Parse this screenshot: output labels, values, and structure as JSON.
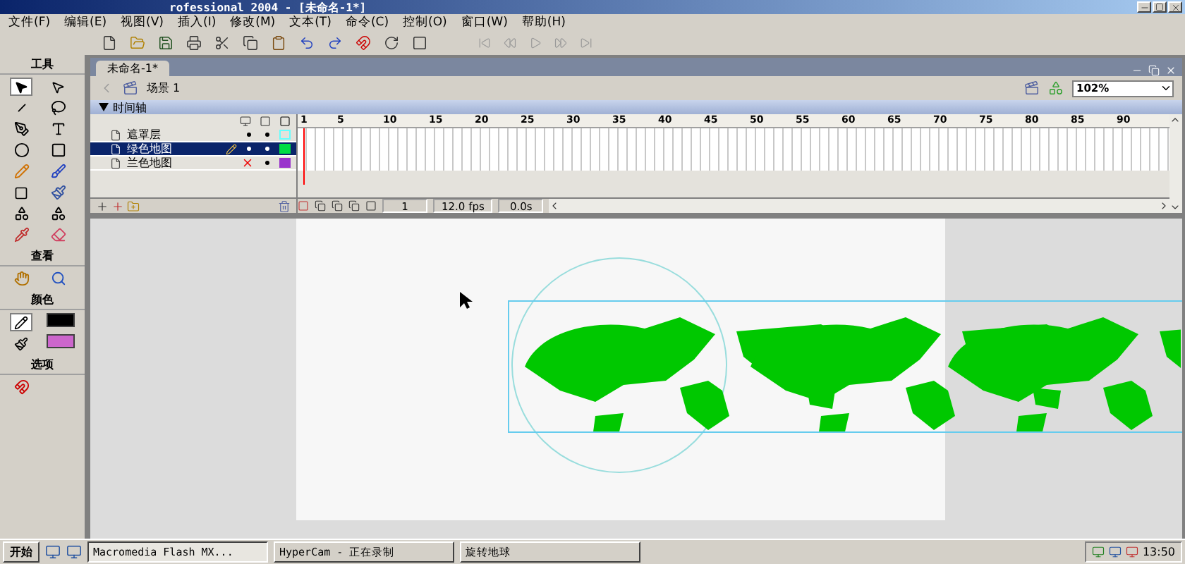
{
  "window": {
    "title": "rofessional 2004 - [未命名-1*]"
  },
  "menu": [
    "文件(F)",
    "编辑(E)",
    "视图(V)",
    "插入(I)",
    "修改(M)",
    "文本(T)",
    "命令(C)",
    "控制(O)",
    "窗口(W)",
    "帮助(H)"
  ],
  "tools_panel": {
    "sections": [
      "工具",
      "查看",
      "颜色",
      "选项"
    ]
  },
  "document": {
    "tab": "未命名-1*",
    "scene": "场景 1",
    "zoom": "102%"
  },
  "timeline": {
    "title": "时间轴",
    "expanded": true,
    "ruler": [
      "1",
      "5",
      "10",
      "15",
      "20",
      "25",
      "30",
      "35",
      "40",
      "45",
      "50",
      "55",
      "60",
      "65",
      "70",
      "75",
      "80",
      "85",
      "90"
    ],
    "layers": [
      {
        "name": "遮罩层",
        "selected": false,
        "hidden": false,
        "color": "#66ffff"
      },
      {
        "name": "绿色地图",
        "selected": true,
        "hidden": false,
        "color": "#00dd44"
      },
      {
        "name": "兰色地图",
        "selected": false,
        "hidden": true,
        "color": "#9933cc"
      }
    ],
    "current_frame": "1",
    "frame_rate": "12.0 fps",
    "elapsed": "0.0s"
  },
  "taskbar": {
    "start": "开始",
    "tasks": [
      {
        "label": "Macromedia Flash MX...",
        "selected": true
      },
      {
        "label": "HyperCam - 正在录制",
        "selected": false
      },
      {
        "label": "旋转地球",
        "selected": false
      }
    ],
    "clock": "13:50"
  }
}
